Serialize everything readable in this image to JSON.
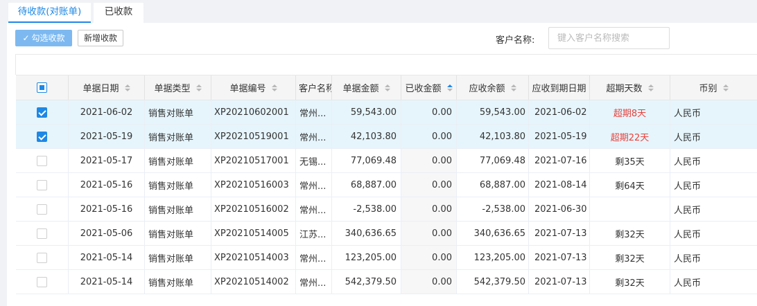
{
  "tabs": [
    {
      "label": "待收款(对账单)",
      "active": true
    },
    {
      "label": "已收款",
      "active": false
    }
  ],
  "toolbar": {
    "check_receive_label": "勾选收款",
    "new_receive_label": "新增收款",
    "customer_label": "客户名称:",
    "customer_placeholder": "键入客户名称搜索",
    "customer_value": ""
  },
  "table": {
    "columns": [
      "单据日期",
      "单据类型",
      "单据编号",
      "客户名称",
      "单据金额",
      "已收金额",
      "应收余额",
      "应收到期日期",
      "超期天数",
      "币别"
    ],
    "rows": [
      {
        "checked": true,
        "date": "2021-06-02",
        "type": "销售对账单",
        "no": "XP20210602001",
        "customer": "常州...",
        "amount": "59,543.00",
        "received": "0.00",
        "balance": "59,543.00",
        "due": "2021-06-02",
        "overdue": "超期8天",
        "overdue_status": "overdue",
        "currency": "人民币"
      },
      {
        "checked": true,
        "date": "2021-05-19",
        "type": "销售对账单",
        "no": "XP20210519001",
        "customer": "常州...",
        "amount": "42,103.80",
        "received": "0.00",
        "balance": "42,103.80",
        "due": "2021-05-19",
        "overdue": "超期22天",
        "overdue_status": "overdue",
        "currency": "人民币"
      },
      {
        "checked": false,
        "date": "2021-05-17",
        "type": "销售对账单",
        "no": "XP20210517001",
        "customer": "无锡...",
        "amount": "77,069.48",
        "received": "0.00",
        "balance": "77,069.48",
        "due": "2021-07-16",
        "overdue": "剩35天",
        "overdue_status": "remaining",
        "currency": "人民币"
      },
      {
        "checked": false,
        "date": "2021-05-16",
        "type": "销售对账单",
        "no": "XP20210516003",
        "customer": "常州...",
        "amount": "68,887.00",
        "received": "0.00",
        "balance": "68,887.00",
        "due": "2021-08-14",
        "overdue": "剩64天",
        "overdue_status": "remaining",
        "currency": "人民币"
      },
      {
        "checked": false,
        "date": "2021-05-16",
        "type": "销售对账单",
        "no": "XP20210516002",
        "customer": "常州...",
        "amount": "-2,538.00",
        "received": "0.00",
        "balance": "-2,538.00",
        "due": "2021-06-30",
        "overdue": "",
        "overdue_status": "none",
        "currency": "人民币"
      },
      {
        "checked": false,
        "date": "2021-05-06",
        "type": "销售对账单",
        "no": "XP20210514005",
        "customer": "江苏...",
        "amount": "340,636.65",
        "received": "0.00",
        "balance": "340,636.65",
        "due": "2021-07-13",
        "overdue": "剩32天",
        "overdue_status": "remaining",
        "currency": "人民币"
      },
      {
        "checked": false,
        "date": "2021-05-14",
        "type": "销售对账单",
        "no": "XP20210514003",
        "customer": "常州...",
        "amount": "123,205.00",
        "received": "0.00",
        "balance": "123,205.00",
        "due": "2021-07-13",
        "overdue": "剩32天",
        "overdue_status": "remaining",
        "currency": "人民币"
      },
      {
        "checked": false,
        "date": "2021-05-14",
        "type": "销售对账单",
        "no": "XP20210514002",
        "customer": "常州...",
        "amount": "542,379.50",
        "received": "0.00",
        "balance": "542,379.50",
        "due": "2021-07-13",
        "overdue": "剩32天",
        "overdue_status": "remaining",
        "currency": "人民币"
      }
    ]
  },
  "colors": {
    "accent": "#1e88e5",
    "primary_button": "#7db9f0",
    "overdue_text": "#e8413b",
    "selected_row": "#e6f5fc"
  }
}
